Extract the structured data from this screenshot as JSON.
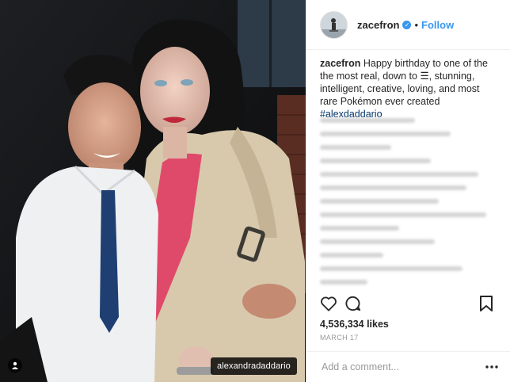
{
  "header": {
    "username": "zacefron",
    "verified_icon": "verified-badge-icon",
    "separator": "•",
    "follow_label": "Follow"
  },
  "photo": {
    "tag_label": "alexandradaddario",
    "tag_icon": "person-tag-icon"
  },
  "caption": {
    "username": "zacefron",
    "text": " Happy birthday to one of the the most real, down to ☰, stunning, intelligent, creative, loving, and most rare Pokémon ever created ",
    "hashtag": "#alexdaddario"
  },
  "actions": {
    "like_icon": "heart-icon",
    "comment_icon": "comment-icon",
    "save_icon": "bookmark-icon"
  },
  "likes_text": "4,536,334 likes",
  "date_text": "MARCH 17",
  "comment_box": {
    "placeholder": "Add a comment...",
    "more_icon": "more-options-icon"
  },
  "colors": {
    "accent": "#3897f0",
    "text": "#262626",
    "muted": "#999999"
  }
}
